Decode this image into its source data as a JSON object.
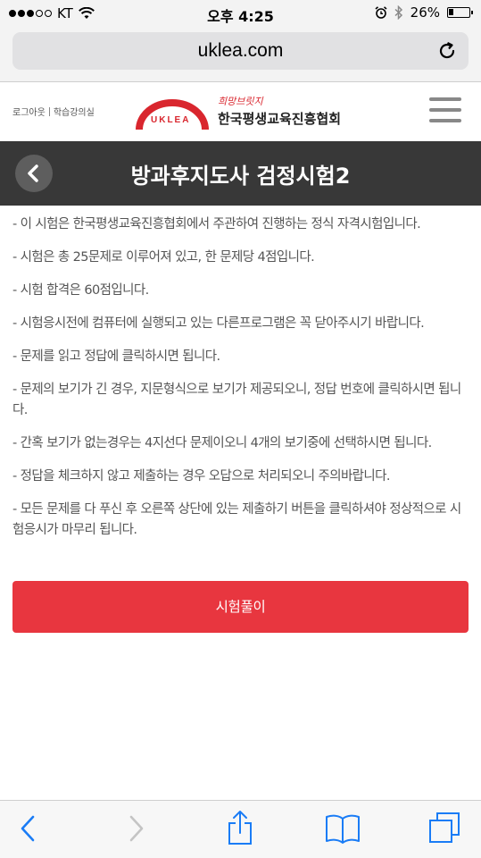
{
  "status_bar": {
    "carrier": "KT",
    "time": "오후 4:25",
    "battery": "26%",
    "battery_level": 0.26
  },
  "browser": {
    "url": "uklea.com"
  },
  "site_header": {
    "logout_link": "로그아웃",
    "classroom_link": "학습강의실",
    "logo_mark": "UKLEA",
    "logo_slogan": "희망브릿지",
    "logo_name": "한국평생교육진흥협회"
  },
  "page": {
    "title": "방과후지도사 검정시험2"
  },
  "notices": [
    "- 이 시험은 한국평생교육진흥협회에서 주관하여 진행하는 정식 자격시험입니다.",
    "- 시험은 총 25문제로 이루어져 있고, 한 문제당 4점입니다.",
    "- 시험 합격은 60점입니다.",
    "- 시험응시전에 컴퓨터에 실행되고 있는 다른프로그램은 꼭 닫아주시기 바랍니다.",
    "- 문제를 읽고 정답에 클릭하시면 됩니다.",
    "- 문제의 보기가 긴 경우, 지문형식으로 보기가 제공되오니, 정답 번호에 클릭하시면 됩니다.",
    "- 간혹 보기가 없는경우는 4지선다 문제이오니 4개의 보기중에 선택하시면 됩니다.",
    "- 정답을 체크하지 않고 제출하는 경우 오답으로 처리되오니 주의바랍니다.",
    "- 모든 문제를 다 푸신 후 오른쪽 상단에 있는 제출하기 버튼을 클릭하셔야 정상적으로 시험응시가 마무리 됩니다."
  ],
  "start_button": {
    "label": "시험풀이"
  },
  "colors": {
    "accent": "#e8363f",
    "title_bar": "#383838",
    "ios_blue": "#1a7cf6"
  },
  "icons": {
    "back": "chevron-left-icon",
    "reload": "reload-icon",
    "menu": "hamburger-icon",
    "share": "share-icon",
    "bookmarks": "book-icon",
    "tabs": "tabs-icon"
  }
}
